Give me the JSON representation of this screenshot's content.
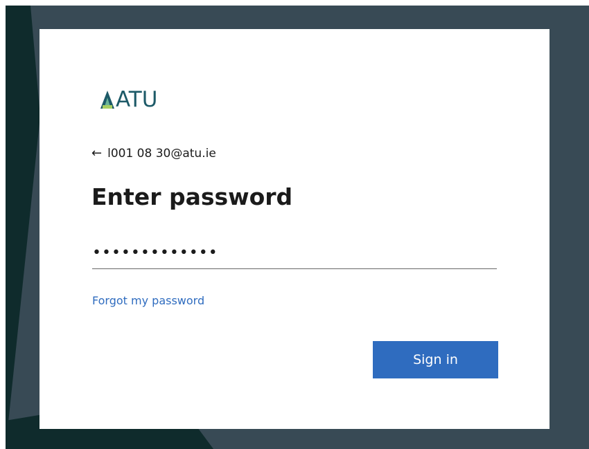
{
  "brand": {
    "logo_text": "ATU",
    "logo_color": "#1d5a68"
  },
  "identity": {
    "back_icon": "arrow-left-icon",
    "email": "l001 08 30@atu.ie"
  },
  "form": {
    "title": "Enter password",
    "password_value": "•••••••••••••",
    "forgot_link": "Forgot my password",
    "submit_label": "Sign in"
  },
  "colors": {
    "accent": "#2f6cbf",
    "background": "#384a55",
    "background_dark": "#0f2b2c"
  }
}
